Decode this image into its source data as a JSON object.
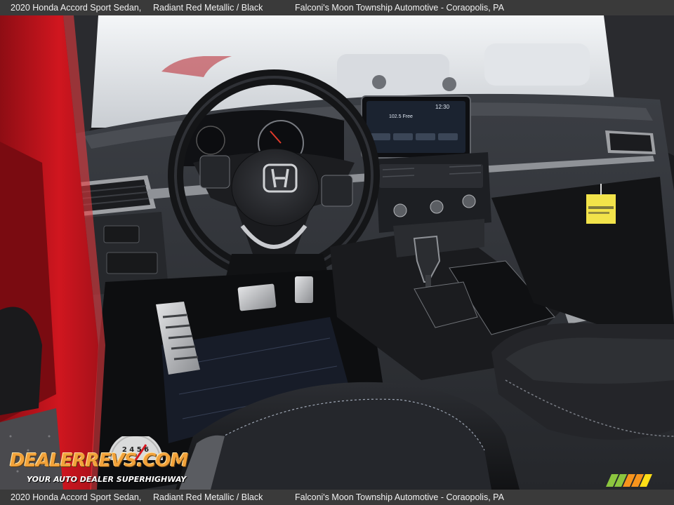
{
  "caption": {
    "model": "2020 Honda Accord Sport Sedan,",
    "color": "Radiant Red Metallic / Black",
    "dealer": "Falconi's Moon Township Automotive - Coraopolis, PA"
  },
  "display": {
    "clock": "12:30",
    "station": "102.5 Free"
  },
  "watermark": {
    "logo": "DEALERREVS.COM",
    "tagline": "YOUR AUTO DEALER SUPERHIGHWAY",
    "gauge_digits": "2 4 5 6"
  },
  "icons": [
    "honda-logo-icon",
    "steering-wheel-icon",
    "gear-shifter-icon"
  ],
  "colors": {
    "caption_bar": "#3a3a3a",
    "door_red": "#c8141e",
    "interior_black": "#1a1b1e",
    "watermark_orange": "#f2a23a",
    "badge_stripes": [
      "#8cc63f",
      "#f7941d",
      "#ffde17"
    ]
  }
}
